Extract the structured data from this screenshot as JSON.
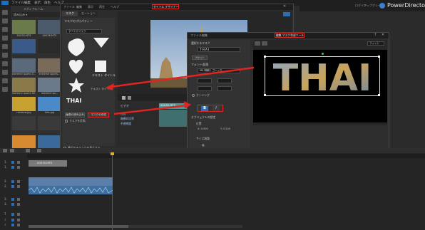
{
  "app": {
    "title": "PowerDirector",
    "menu": [
      "ファイル",
      "編集",
      "表示",
      "再生",
      "ヘルプ"
    ],
    "brand_badge": "CyberLink",
    "top_right": [
      "ログイン",
      "アップグレード"
    ]
  },
  "library": {
    "tab": "メディアルーム",
    "toolbar_label": "読み込み ▾",
    "items": [
      {
        "caption": "00035.MTS",
        "color": "#6a7a4a"
      },
      {
        "caption": "00036.MTS",
        "color": "#4a5a6a"
      },
      {
        "caption": "",
        "color": "#3a5a8a"
      },
      {
        "caption": "",
        "color": "#2a2a2a"
      },
      {
        "caption": "extreme sports 0...",
        "color": "#5a6a7a"
      },
      {
        "caption": "extreme sports...",
        "color": "#7a6a5a"
      },
      {
        "caption": "extreme sports 02...",
        "color": "#8a7a4a"
      },
      {
        "caption": "extreme sp...",
        "color": "#6a7a8a"
      },
      {
        "caption": "rainbow.jpg",
        "color": "#c8a030"
      },
      {
        "caption": "kite.jpg",
        "color": "#4a8ac8"
      },
      {
        "caption": "",
        "color": "#3a3a3a"
      },
      {
        "caption": "",
        "color": "#3a3a3a"
      },
      {
        "caption": "sunrise.jpg",
        "color": "#d88a30"
      },
      {
        "caption": "",
        "color": "#3a6a9a"
      }
    ]
  },
  "title_designer": {
    "window_title": "タイトル デザイナー - 00035",
    "menu": [
      "ファイル",
      "編集",
      "表示",
      "再生",
      "ヘルプ"
    ],
    "tabs": [
      "マスク",
      "モーション"
    ],
    "section": "マスクのプロパティー",
    "dropdown": "すべてのマスク",
    "shape_captions": [
      "",
      "",
      "ハート",
      "",
      "テキスト タイトル"
    ],
    "text_title_caption": "テキスト タイトル",
    "thai_label": "THAI",
    "import_button": "画像の読み込み",
    "custom_button": "マスクの作成",
    "checkbox_label": "マスクを反転",
    "timecode": "00;00;07;07",
    "track_header": "ビデオ",
    "track_clip": "00035.MTS",
    "track_rows": [
      "位置",
      "縦横の比率",
      "不透明度"
    ],
    "footer_checkbox": "最初のみマスクを表示する"
  },
  "mask_designer": {
    "window_title": "編集 マスク作成ツール",
    "menu": [
      "ファイル",
      "編集"
    ],
    "section_text": "選択するマスク",
    "text_value": "T H A I",
    "text_link": "リセット",
    "font_section": "フォント/段落",
    "font_name": "MS 明朝 / ゴシック",
    "bold": "B",
    "italic": "I",
    "kerning_label": "カーニング",
    "object_section": "オブジェクトの設定",
    "position_label": "位置",
    "x_label": "X: 0.500",
    "y_label": "Y: 0.500",
    "size_label": "サイズ調整",
    "width_label": "幅",
    "height_label": "高さ",
    "width_value": "1.00",
    "height_value": "1.00",
    "keep_ratio": "縦横比を保持",
    "preview_text": "THAI",
    "zoom": "フィット",
    "ok": "OK",
    "cancel": "キャンセル"
  },
  "timeline": {
    "clip_title": "00035.MTS",
    "track_numbers": [
      "1.",
      "1.",
      "2.",
      "2.",
      "3.",
      "3.",
      "T",
      "♪",
      "♪"
    ]
  },
  "colors": {
    "red": "#e0241f",
    "dark": "#232323",
    "panel": "#2f2f2f",
    "accent": "#2a6fb5",
    "teal": "#4a9a9a"
  }
}
